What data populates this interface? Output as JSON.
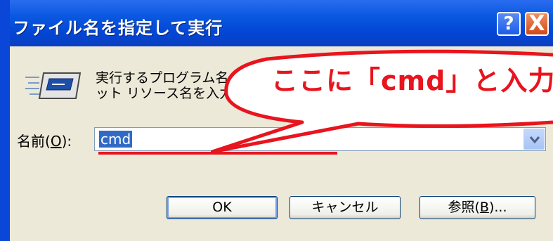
{
  "window": {
    "title": "ファイル名を指定して実行",
    "help_button": "?",
    "close_button": "X"
  },
  "description": {
    "line1": "実行するプログラム名",
    "line2": "ット リソース名を入力して"
  },
  "name_field": {
    "label_prefix": "名前(",
    "label_accel": "O",
    "label_suffix": "):",
    "value": "cmd"
  },
  "buttons": {
    "ok": "OK",
    "cancel": "キャンセル",
    "browse_prefix": "参照(",
    "browse_accel": "B",
    "browse_suffix": ")..."
  },
  "annotation": {
    "text": "ここに「cmd」と入力",
    "color": "#e8141e"
  },
  "icons": [
    "run-program-icon",
    "help-icon",
    "close-icon",
    "dropdown-arrow-icon"
  ]
}
